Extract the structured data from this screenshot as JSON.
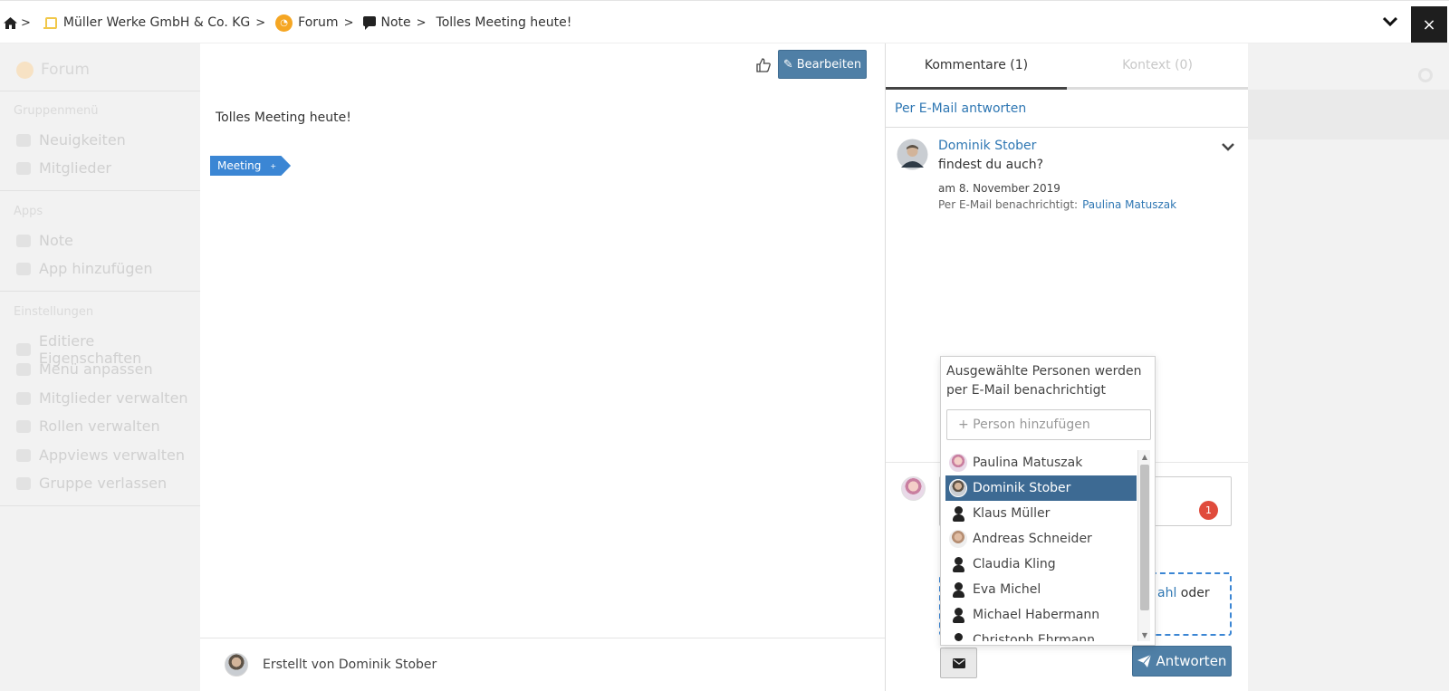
{
  "breadcrumb": {
    "items": [
      {
        "label": "Müller Werke GmbH & Co. KG",
        "icon": "company-icon"
      },
      {
        "label": "Forum",
        "icon": "forum-icon"
      },
      {
        "label": "Note",
        "icon": "note-icon"
      },
      {
        "label": "Tolles Meeting heute!"
      }
    ],
    "home_icon": "home-icon",
    "separator": ">",
    "close_label": "×"
  },
  "sidebar": {
    "title": "Forum",
    "group_menu_heading": "Gruppenmenü",
    "group_menu": [
      {
        "label": "Neuigkeiten",
        "icon": "bell-icon"
      },
      {
        "label": "Mitglieder",
        "icon": "users-icon"
      }
    ],
    "apps_heading": "Apps",
    "apps": [
      {
        "label": "Note",
        "icon": "note-icon"
      },
      {
        "label": "App hinzufügen",
        "icon": "plus-icon"
      }
    ],
    "settings_heading": "Einstellungen",
    "settings": [
      {
        "label": "Editiere Eigenschaften",
        "icon": "edit-icon"
      },
      {
        "label": "Menü anpassen",
        "icon": "edit-icon"
      },
      {
        "label": "Mitglieder verwalten",
        "icon": "users-icon"
      },
      {
        "label": "Rollen verwalten",
        "icon": "users-icon"
      },
      {
        "label": "Appviews verwalten",
        "icon": "lock-icon"
      },
      {
        "label": "Gruppe verlassen",
        "icon": "users-icon"
      }
    ]
  },
  "post": {
    "edit_label": "Bearbeiten",
    "text": "Tolles Meeting heute!",
    "tag": "Meeting",
    "tag_remove": "+",
    "created_by": "Erstellt von Dominik Stober"
  },
  "panel": {
    "tabs": [
      {
        "label": "Kommentare",
        "count": "(1)",
        "active": true
      },
      {
        "label": "Kontext",
        "count": "(0)",
        "active": false
      }
    ],
    "email_reply_label": "Per E-Mail antworten",
    "comment": {
      "author": "Dominik Stober",
      "text": "findest du auch?",
      "date": "am 8. November 2019",
      "notified_label": "Per E-Mail benachrichtigt:",
      "notified_person": "Paulina Matuszak"
    },
    "badge_count": "1",
    "dropzone_link": "ahl",
    "dropzone_text": " oder",
    "reply_label": "Antworten"
  },
  "notify_popup": {
    "title": "Ausgewählte Personen werden per E-Mail benachrichtigt",
    "placeholder": "+ Person hinzufügen",
    "people": [
      {
        "name": "Paulina Matuszak",
        "avatar": "pm",
        "selected": false
      },
      {
        "name": "Dominik Stober",
        "avatar": "ds",
        "selected": true
      },
      {
        "name": "Klaus Müller",
        "avatar": "ph",
        "selected": false
      },
      {
        "name": "Andreas Schneider",
        "avatar": "as",
        "selected": false
      },
      {
        "name": "Claudia Kling",
        "avatar": "ph",
        "selected": false
      },
      {
        "name": "Eva Michel",
        "avatar": "ph",
        "selected": false
      },
      {
        "name": "Michael Habermann",
        "avatar": "ph",
        "selected": false
      },
      {
        "name": "Christoph Ehrmann",
        "avatar": "ph",
        "selected": false
      }
    ]
  },
  "colors": {
    "primary_button": "#4f7fa6",
    "link": "#2f77b3",
    "tag": "#3b86d4",
    "selected_row": "#3d6a93",
    "badge": "#e04b3c"
  }
}
